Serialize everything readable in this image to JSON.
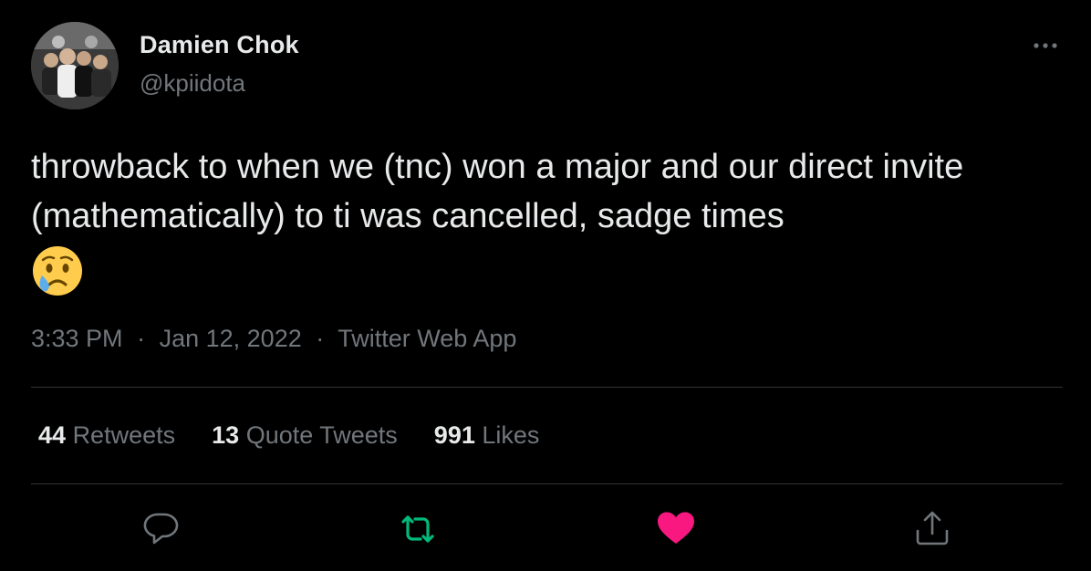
{
  "author": {
    "name": "Damien Chok",
    "handle": "@kpiidota"
  },
  "tweet": {
    "text": "throwback to when we (tnc) won a major and our direct invite (mathematically) to ti was cancelled, sadge times",
    "emoji": "crying-face"
  },
  "meta": {
    "time": "3:33 PM",
    "separator": "·",
    "date": "Jan 12, 2022",
    "source": "Twitter Web App"
  },
  "stats": {
    "retweets_count": "44",
    "retweets_label": "Retweets",
    "quotes_count": "13",
    "quotes_label": "Quote Tweets",
    "likes_count": "991",
    "likes_label": "Likes"
  },
  "actions": {
    "retweeted": true,
    "liked": true
  },
  "colors": {
    "background": "#000000",
    "primary_text": "#e7e9ea",
    "secondary_text": "#71767b",
    "retweet_green": "#00ba7c",
    "like_pink": "#f91880",
    "divider": "#2f3336"
  }
}
